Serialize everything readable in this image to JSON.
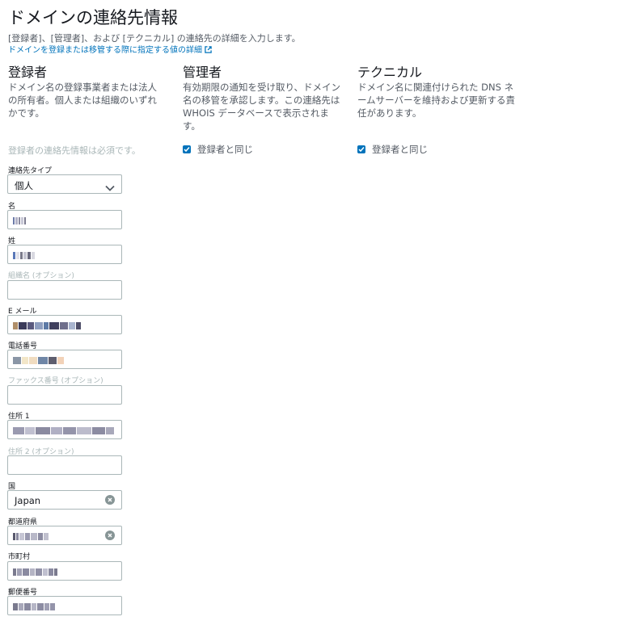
{
  "page": {
    "title": "ドメインの連絡先情報",
    "description": "[登録者]、[管理者]、および [テクニカル] の連絡先の詳細を入力します。",
    "link": "ドメインを登録または移管する際に指定する値の詳細"
  },
  "columns": {
    "registrant": {
      "heading": "登録者",
      "description": "ドメイン名の登録事業者または法人の所有者。個人または組織のいずれかです。",
      "required_note": "登録者の連絡先情報は必須です。"
    },
    "admin": {
      "heading": "管理者",
      "description": "有効期限の通知を受け取り、ドメイン名の移管を承認します。この連絡先は WHOIS データベースで表示されます。",
      "checkbox_label": "登録者と同じ",
      "checked": true
    },
    "tech": {
      "heading": "テクニカル",
      "description": "ドメイン名に関連付けられた DNS ネームサーバーを維持および更新する責任があります。",
      "checkbox_label": "登録者と同じ",
      "checked": true
    }
  },
  "form": {
    "contact_type": {
      "label": "連絡先タイプ",
      "value": "個人"
    },
    "first_name": {
      "label": "名",
      "value": ""
    },
    "last_name": {
      "label": "姓",
      "value": ""
    },
    "organization": {
      "label": "組織名 (オプション)",
      "value": ""
    },
    "email": {
      "label": "E メール",
      "value": ""
    },
    "phone": {
      "label": "電話番号",
      "value": ""
    },
    "fax": {
      "label": "ファックス番号 (オプション)",
      "value": ""
    },
    "address1": {
      "label": "住所 1",
      "value": ""
    },
    "address2": {
      "label": "住所 2 (オプション)",
      "value": ""
    },
    "country": {
      "label": "国",
      "value": "Japan"
    },
    "state": {
      "label": "都道府県",
      "value": ""
    },
    "city": {
      "label": "市町村",
      "value": ""
    },
    "postal_code": {
      "label": "郵便番号",
      "value": ""
    }
  },
  "colors": {
    "accent": "#0073bb",
    "text": "#16191f",
    "muted": "#545b64",
    "border": "#aab7b8"
  }
}
